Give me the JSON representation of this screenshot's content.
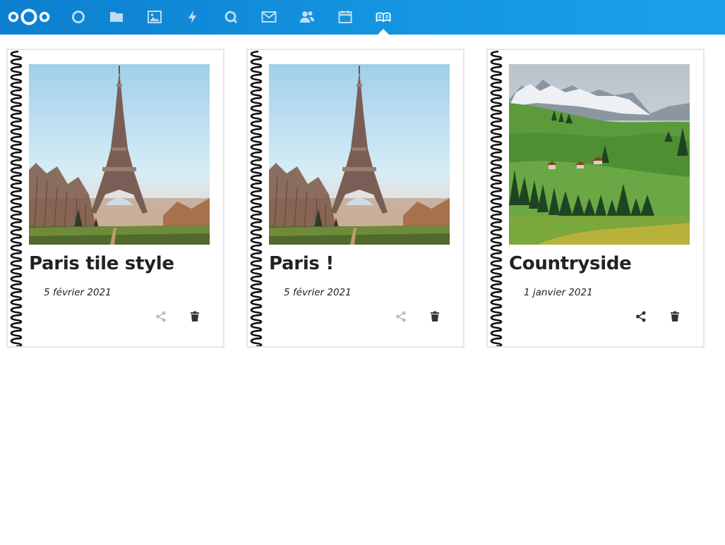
{
  "app": {
    "name": "Nextcloud",
    "colors": {
      "header_start": "#0c7fcf",
      "header_end": "#1aa0ea",
      "icon": "#ffffff",
      "card_border": "#e6e6e6"
    }
  },
  "nav": {
    "items": [
      {
        "icon": "dashboard-icon",
        "label": "Dashboard",
        "active": false
      },
      {
        "icon": "folder-icon",
        "label": "Files",
        "active": false
      },
      {
        "icon": "image-icon",
        "label": "Photos",
        "active": false
      },
      {
        "icon": "lightning-icon",
        "label": "Activity",
        "active": false
      },
      {
        "icon": "search-icon",
        "label": "Search",
        "active": false
      },
      {
        "icon": "mail-icon",
        "label": "Mail",
        "active": false
      },
      {
        "icon": "contacts-icon",
        "label": "Contacts",
        "active": false
      },
      {
        "icon": "calendar-icon",
        "label": "Calendar",
        "active": false
      },
      {
        "icon": "book-icon",
        "label": "Cookbook",
        "active": true
      }
    ]
  },
  "cards": [
    {
      "title": "Paris tile style",
      "date": "5 février 2021",
      "cover": "eiffel-tower-image",
      "share_enabled": false
    },
    {
      "title": "Paris !",
      "date": "5 février 2021",
      "cover": "eiffel-tower-image",
      "share_enabled": false
    },
    {
      "title": "Countryside",
      "date": "1 janvier 2021",
      "cover": "countryside-image",
      "share_enabled": true
    }
  ]
}
